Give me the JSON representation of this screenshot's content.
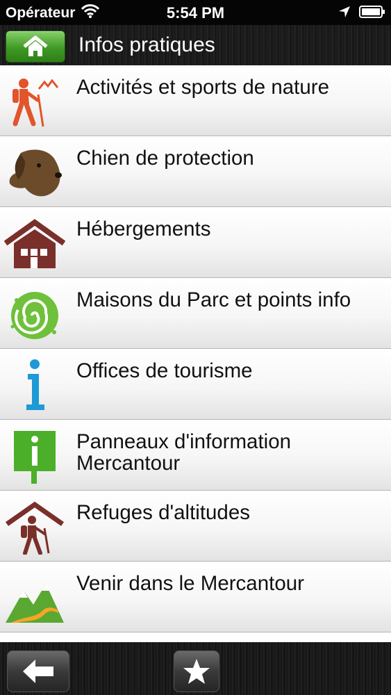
{
  "status_bar": {
    "carrier": "Opérateur",
    "time": "5:54 PM"
  },
  "nav": {
    "title": "Infos pratiques"
  },
  "items": [
    {
      "label": "Activités et sports de nature",
      "icon": "hiker-mountains-icon"
    },
    {
      "label": "Chien de protection",
      "icon": "dog-head-icon"
    },
    {
      "label": "Hébergements",
      "icon": "house-icon"
    },
    {
      "label": "Maisons du Parc et points info",
      "icon": "green-spiral-icon"
    },
    {
      "label": "Offices de tourisme",
      "icon": "info-i-icon"
    },
    {
      "label": "Panneaux d'information Mercantour",
      "icon": "info-sign-panel-icon"
    },
    {
      "label": "Refuges d'altitudes",
      "icon": "hiker-shelter-icon"
    },
    {
      "label": "Venir dans le Mercantour",
      "icon": "mountain-road-icon"
    }
  ],
  "colors": {
    "home_green": "#3f9a24",
    "hiker_orange": "#e2542a",
    "house_brown": "#7a2f2a",
    "info_blue": "#1e9ad6",
    "sign_green": "#4caf2a"
  }
}
